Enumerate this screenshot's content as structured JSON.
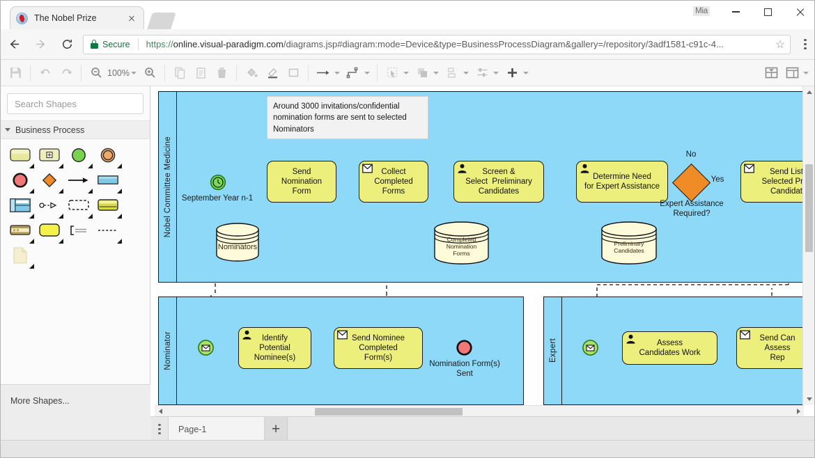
{
  "browser": {
    "tab": {
      "title": "The Nobel Prize",
      "favicon": "nobel-medal-icon",
      "close": "×"
    },
    "profile_name": "Mia",
    "window": {
      "minimize": "–",
      "maximize": "□",
      "close": "×"
    },
    "nav": {
      "back": "back-arrow",
      "forward": "forward-arrow",
      "reload": "reload-arrow"
    },
    "address": {
      "security_label": "Secure",
      "url_scheme": "https://",
      "url_host": "online.visual-paradigm.com",
      "url_path": "/diagrams.jsp#diagram:mode=Device&type=BusinessProcessDiagram&gallery=/repository/3adf1581-c91c-4...",
      "bookmark_icon": "☆"
    }
  },
  "toolbar": {
    "save": "save-icon",
    "undo": "undo-icon",
    "redo": "redo-icon",
    "zoom_out": "zoom-out-icon",
    "zoom_level": "100%",
    "zoom_in": "zoom-in-icon",
    "copy": "copy-icon",
    "paste": "paste-icon",
    "delete": "trash-icon",
    "fill": "fill-color-icon",
    "line": "line-color-icon",
    "shape_style": "shape-style-icon",
    "connector": "connector-icon",
    "connector_route": "connector-route-icon",
    "select": "select-icon",
    "arrange": "arrange-icon",
    "distribute": "distribute-icon",
    "align": "align-icon",
    "add": "+",
    "layout_panel": "layout-panel-icon",
    "view_panel": "view-panel-icon"
  },
  "left_panel": {
    "search": {
      "placeholder": "Search Shapes",
      "value": "",
      "icon": "search-icon"
    },
    "section": {
      "title": "Business Process",
      "expanded": true
    },
    "shapes": [
      {
        "name": "task-shape"
      },
      {
        "name": "subprocess-shape"
      },
      {
        "name": "start-event-shape"
      },
      {
        "name": "intermediate-event-shape"
      },
      {
        "name": "end-event-shape"
      },
      {
        "name": "gateway-shape"
      },
      {
        "name": "sequence-flow-shape"
      },
      {
        "name": "pool-shape"
      },
      {
        "name": "lane-shape"
      },
      {
        "name": "data-object-shape"
      },
      {
        "name": "group-shape"
      },
      {
        "name": "data-store-shape"
      },
      {
        "name": "horizontal-pool-shape"
      },
      {
        "name": "rounded-task-shape"
      },
      {
        "name": "annotation-shape"
      },
      {
        "name": "association-shape"
      },
      {
        "name": "note-shape"
      }
    ],
    "more_shapes": "More Shapes..."
  },
  "diagram": {
    "type": "BusinessProcessDiagram",
    "pools": [
      {
        "id": "pool-nobel",
        "label": "Nobel Committee Medicine",
        "tasks": [
          {
            "id": "t1",
            "label": "Send\nNomination\nForm",
            "icon": "none"
          },
          {
            "id": "t2",
            "label": "Collect\nCompleted\nForms",
            "icon": "message-icon"
          },
          {
            "id": "t3",
            "label": "Screen &\nSelect  Preliminary\nCandidates",
            "icon": "user-icon"
          },
          {
            "id": "t4",
            "label": "Determine Need\nfor Expert Assistance",
            "icon": "user-icon"
          },
          {
            "id": "t5",
            "label": "Send List\nSelected Preli\nCandidat",
            "icon": "message-icon"
          }
        ],
        "events": [
          {
            "id": "e1",
            "type": "timer-start-event",
            "label": "September Year n-1"
          }
        ],
        "gateways": [
          {
            "id": "g1",
            "type": "exclusive-gateway",
            "label": "Expert Assistance\nRequired?",
            "flows": [
              "No",
              "Yes"
            ]
          }
        ],
        "data_stores": [
          {
            "id": "d1",
            "label": "Nominators"
          },
          {
            "id": "d2",
            "label": "Completed\nNomination\nForms"
          },
          {
            "id": "d3",
            "label": "Preliminary\nCandidates"
          }
        ],
        "notes": [
          {
            "id": "n1",
            "text": "Around 3000 invitations/confidential nomination forms are sent to selected Nominators"
          }
        ]
      },
      {
        "id": "pool-nominator",
        "label": "Nominator",
        "tasks": [
          {
            "id": "t6",
            "label": "Identify\nPotential\nNominee(s)",
            "icon": "user-icon"
          },
          {
            "id": "t7",
            "label": "Send Nominee\nCompleted\nForm(s)",
            "icon": "message-icon"
          }
        ],
        "events": [
          {
            "id": "e2",
            "type": "message-start-event",
            "label": ""
          },
          {
            "id": "e3",
            "type": "message-end-event",
            "label": "Nomination Form(s)\nSent"
          }
        ]
      },
      {
        "id": "pool-expert",
        "label": "Expert",
        "tasks": [
          {
            "id": "t8",
            "label": "Assess\nCandidates Work",
            "icon": "user-icon"
          },
          {
            "id": "t9",
            "label": "Send Can\nAssess\nRep",
            "icon": "message-icon"
          }
        ],
        "events": [
          {
            "id": "e4",
            "type": "message-start-event",
            "label": ""
          }
        ]
      }
    ],
    "colors": {
      "pool_fill": "#8ED8F8",
      "task_fill": "#EDEF7C",
      "gateway_fill": "#F08C28",
      "start_event_fill": "#7ADB56",
      "end_event_fill": "#F07878",
      "data_store_fill": "#FDFBD9",
      "stroke": "#1A1A1A",
      "note_fill": "#F2F2F2"
    }
  },
  "page_bar": {
    "menu_icon": "page-menu-icon",
    "page_tab": "Page-1",
    "add_page": "+"
  },
  "scrollbars": {
    "vertical": {
      "up": "▲",
      "down": "▼"
    },
    "horizontal": {
      "left": "◀",
      "right": "▶"
    }
  }
}
